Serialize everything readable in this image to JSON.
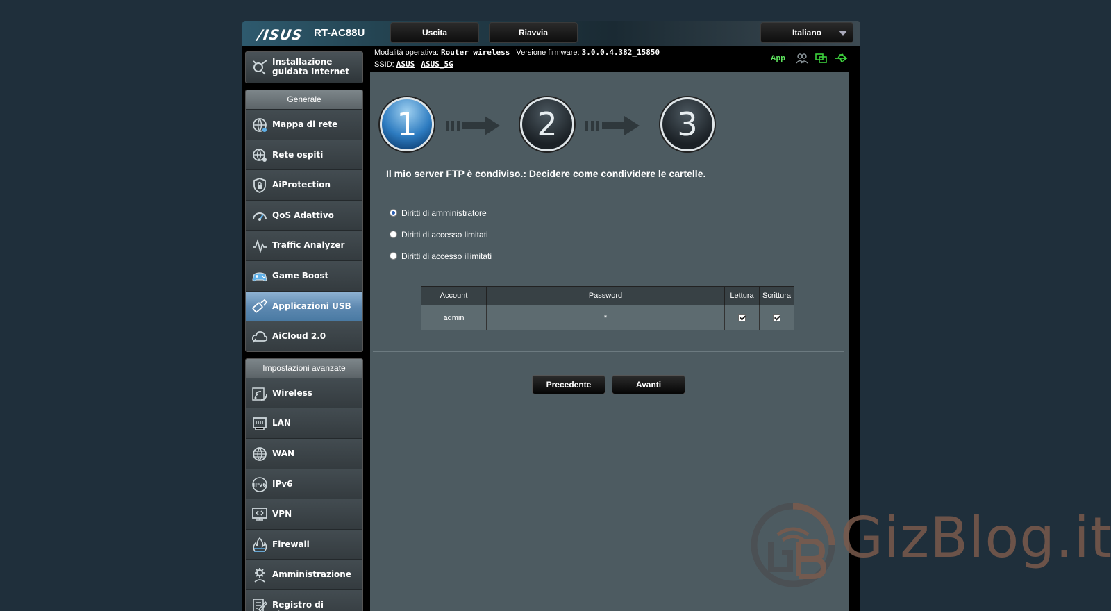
{
  "header": {
    "brand": "/ISUS",
    "model": "RT-AC88U",
    "logout_label": "Uscita",
    "reboot_label": "Riavvia",
    "language": "Italiano"
  },
  "infobar": {
    "mode_label": "Modalità operativa:",
    "mode_value": "Router wireless",
    "firmware_label": "Versione firmware:",
    "firmware_value": "3.0.0.4.382_15850",
    "ssid_label": "SSID:",
    "ssid_1": "ASUS",
    "ssid_2": "ASUS_5G",
    "app_label": "App"
  },
  "sidebar": {
    "wizard": "Installazione guidata Internet",
    "general_header": "Generale",
    "general_items": [
      {
        "label": "Mappa di rete",
        "icon": "network-map-icon"
      },
      {
        "label": "Rete ospiti",
        "icon": "guest-network-icon"
      },
      {
        "label": "AiProtection",
        "icon": "shield-lock-icon"
      },
      {
        "label": "QoS Adattivo",
        "icon": "gauge-icon"
      },
      {
        "label": "Traffic Analyzer",
        "icon": "traffic-analyzer-icon"
      },
      {
        "label": "Game Boost",
        "icon": "gamepad-icon"
      },
      {
        "label": "Applicazioni USB",
        "icon": "usb-apps-icon",
        "active": true
      },
      {
        "label": "AiCloud 2.0",
        "icon": "cloud-icon"
      }
    ],
    "advanced_header": "Impostazioni avanzate",
    "advanced_items": [
      {
        "label": "Wireless",
        "icon": "wifi-icon"
      },
      {
        "label": "LAN",
        "icon": "lan-icon"
      },
      {
        "label": "WAN",
        "icon": "globe-icon"
      },
      {
        "label": "IPv6",
        "icon": "ipv6-icon"
      },
      {
        "label": "VPN",
        "icon": "vpn-icon"
      },
      {
        "label": "Firewall",
        "icon": "firewall-icon"
      },
      {
        "label": "Amministrazione",
        "icon": "gear-admin-icon"
      },
      {
        "label": "Registro di sistema",
        "icon": "log-icon"
      }
    ]
  },
  "wizard": {
    "steps": [
      "1",
      "2",
      "3"
    ],
    "current_step": 1,
    "title": "Il mio server FTP è condiviso.: Decidere come condividere le cartelle.",
    "options": [
      {
        "label": "Diritti di amministratore",
        "selected": true
      },
      {
        "label": "Diritti di accesso limitati",
        "selected": false
      },
      {
        "label": "Diritti di accesso illimitati",
        "selected": false
      }
    ],
    "table": {
      "headers": [
        "Account",
        "Password",
        "Lettura",
        "Scrittura"
      ],
      "rows": [
        {
          "account": "admin",
          "password": "*",
          "read": true,
          "write": true
        }
      ]
    },
    "prev_label": "Precedente",
    "next_label": "Avanti"
  },
  "watermark": "GizBlog.it",
  "colors": {
    "page_bg": "#1f2f3b",
    "content_bg": "#4d5b61",
    "active_menu": "#5d88b0",
    "app_green": "#5ee35e",
    "watermark": "#7a5a4c"
  }
}
